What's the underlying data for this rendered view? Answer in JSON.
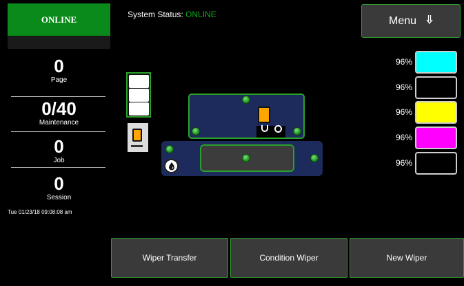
{
  "status_badge": "ONLINE",
  "header": {
    "status_label": "System Status:",
    "status_value": "ONLINE"
  },
  "menu": {
    "label": "Menu",
    "icon": "double-arrow-down-icon"
  },
  "stats": [
    {
      "value": "0",
      "label": "Page"
    },
    {
      "value": "0/40",
      "label": "Maintenance"
    },
    {
      "value": "0",
      "label": "Job"
    },
    {
      "value": "0",
      "label": "Session"
    }
  ],
  "datetime": "Tue 01/23/18 09:08:08 am",
  "inks": [
    {
      "percent": "96%",
      "color": "#00ffff"
    },
    {
      "percent": "96%",
      "color": "#000000"
    },
    {
      "percent": "96%",
      "color": "#ffff00"
    },
    {
      "percent": "96%",
      "color": "#ff00ff"
    },
    {
      "percent": "96%",
      "color": "#000000"
    }
  ],
  "actions": {
    "wiper_transfer": "Wiper Transfer",
    "condition_wiper": "Condition Wiper",
    "new_wiper": "New Wiper"
  },
  "colors": {
    "accent_green": "#2aa12a",
    "status_green": "#0fa61c",
    "tray_blue": "#1d2a5c"
  }
}
